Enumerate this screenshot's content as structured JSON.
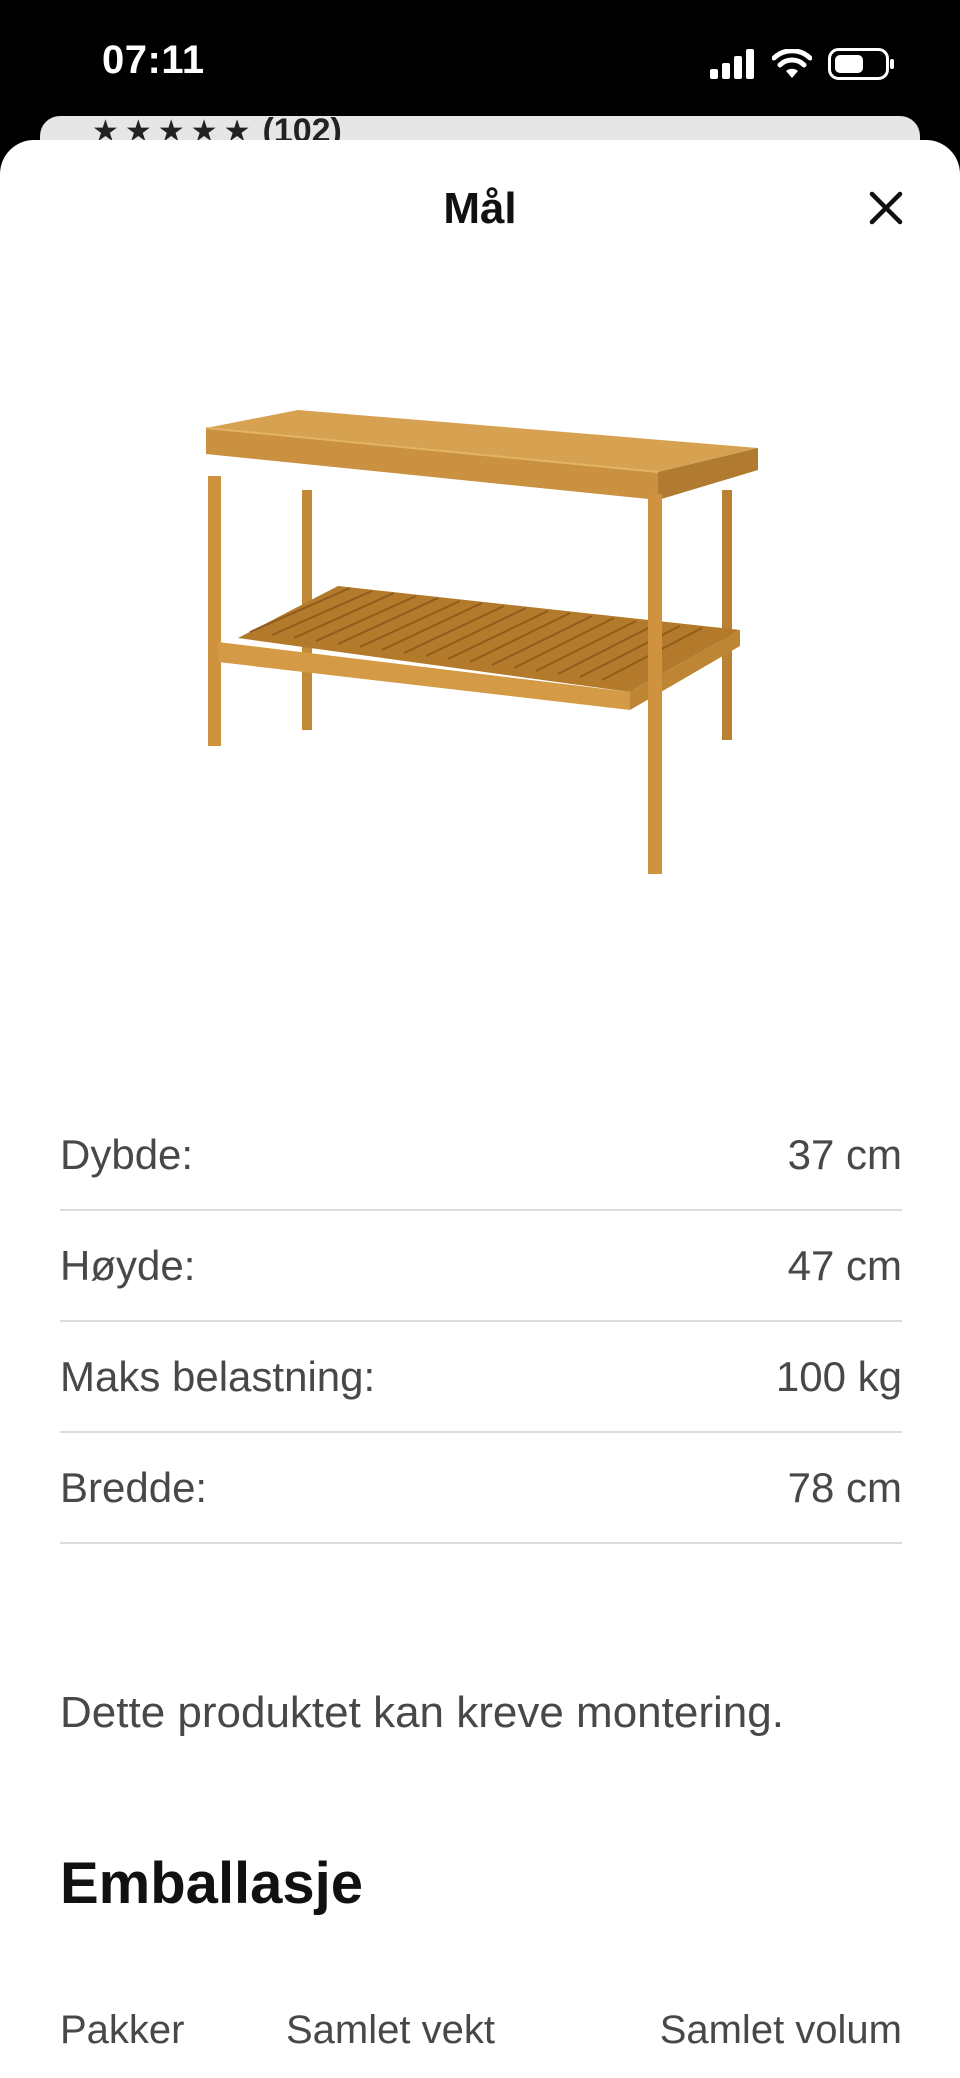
{
  "status_bar": {
    "time": "07:11",
    "icons": [
      "cellular-signal-icon",
      "wifi-icon",
      "battery-icon"
    ]
  },
  "background_card": {
    "rating_stars": "★★★★★",
    "rating_count": "(102)"
  },
  "sheet": {
    "title": "Mål",
    "close_icon": "close-icon"
  },
  "product_image": {
    "description_icon": "bench-image"
  },
  "dimensions": [
    {
      "label": "Dybde:",
      "value": "37 cm"
    },
    {
      "label": "Høyde:",
      "value": "47 cm"
    },
    {
      "label": "Maks belastning:",
      "value": "100 kg"
    },
    {
      "label": "Bredde:",
      "value": "78 cm"
    }
  ],
  "assembly_note": "Dette produktet kan kreve montering.",
  "packaging": {
    "heading": "Emballasje",
    "columns": [
      "Pakker",
      "Samlet vekt",
      "Samlet volum"
    ]
  },
  "colors": {
    "wood": "#C98E3A",
    "text": "#484848",
    "divider": "#dcdcdc"
  }
}
